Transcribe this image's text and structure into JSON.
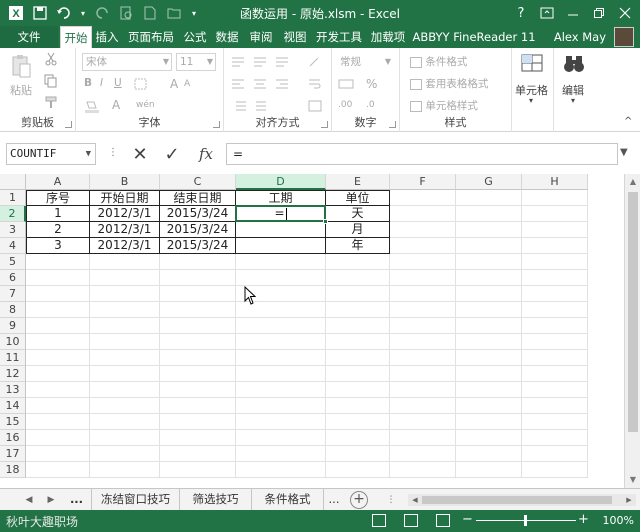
{
  "window": {
    "title": "函数运用 - 原始.xlsm - Excel",
    "help": "?",
    "buttons": [
      "ribbon-options",
      "minimize",
      "restore",
      "close"
    ]
  },
  "ribbon_tabs": [
    "文件",
    "开始",
    "插入",
    "页面布局",
    "公式",
    "数据",
    "审阅",
    "视图",
    "开发工具",
    "加载项",
    "ABBYY FineReader 11"
  ],
  "active_tab": "开始",
  "user": "Alex May",
  "ribbon": {
    "clipboard": {
      "paste": "粘贴",
      "label": "剪贴板"
    },
    "font": {
      "font_name": "宋体",
      "font_size": "11",
      "bold": "B",
      "italic": "I",
      "underline": "U",
      "wen": "wén",
      "grow": "A",
      "shrink": "A",
      "label": "字体"
    },
    "alignment": {
      "label": "对齐方式"
    },
    "number": {
      "format": "常规",
      "percent": "%",
      "label": "数字"
    },
    "styles": {
      "conditional": "条件格式",
      "table": "套用表格格式",
      "cell": "单元格样式",
      "label": "样式"
    },
    "cells": {
      "label": "单元格"
    },
    "editing": {
      "label": "编辑"
    }
  },
  "formula_bar": {
    "name_box": "COUNTIF",
    "cancel": "✕",
    "enter": "✓",
    "fx": "fx",
    "content": "="
  },
  "sheet": {
    "columns": [
      "A",
      "B",
      "C",
      "D",
      "E",
      "F",
      "G",
      "H"
    ],
    "rows": [
      "1",
      "2",
      "3",
      "4",
      "5",
      "6",
      "7",
      "8",
      "9",
      "10",
      "11",
      "12",
      "13",
      "14",
      "15",
      "16",
      "17",
      "18"
    ],
    "selected_column": "D",
    "selected_row": "2",
    "headers": [
      "序号",
      "开始日期",
      "结束日期",
      "工期",
      "单位"
    ],
    "data": [
      [
        "1",
        "2012/3/1",
        "2015/3/24",
        "=",
        "天"
      ],
      [
        "2",
        "2012/3/1",
        "2015/3/24",
        "",
        "月"
      ],
      [
        "3",
        "2012/3/1",
        "2015/3/24",
        "",
        "年"
      ]
    ]
  },
  "sheet_tabs": {
    "ellipsis_left": "...",
    "tabs": [
      "冻结窗口技巧",
      "筛选技巧",
      "条件格式"
    ],
    "ellipsis_right": "..."
  },
  "status_bar": {
    "watermark": "秋叶大趣职场",
    "zoom": "100%"
  },
  "colors": {
    "excel_green": "#217346",
    "selection_bg": "#d3f0e0"
  }
}
